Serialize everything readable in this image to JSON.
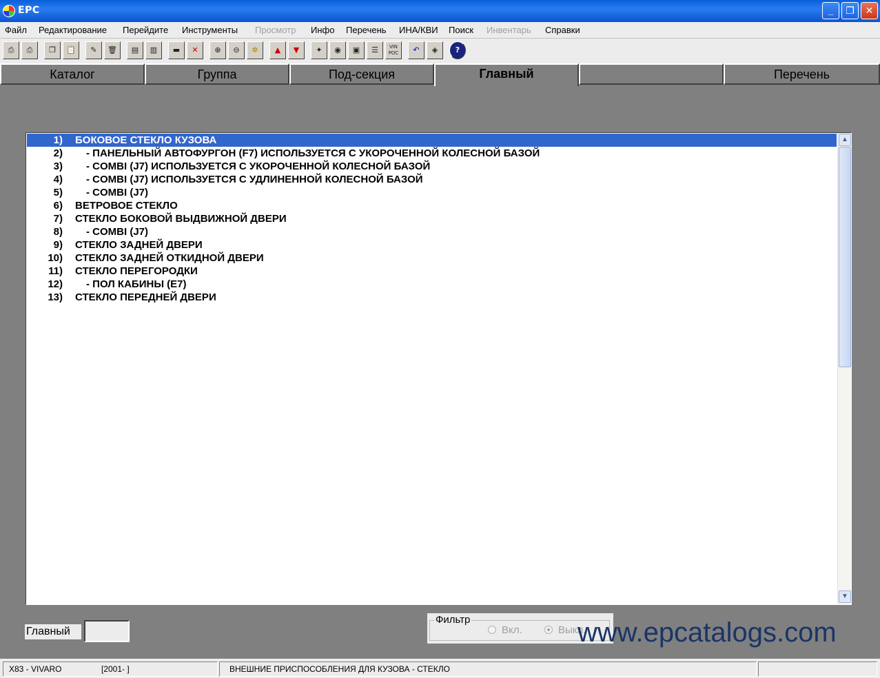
{
  "window": {
    "title": "EPC"
  },
  "menu": [
    {
      "label": "Файл",
      "enabled": true
    },
    {
      "label": "Редактирование",
      "enabled": true
    },
    {
      "label": "Перейдите",
      "enabled": true
    },
    {
      "label": "Инструменты",
      "enabled": true
    },
    {
      "label": "Просмотр",
      "enabled": false
    },
    {
      "label": "Инфо",
      "enabled": true
    },
    {
      "label": "Перечень",
      "enabled": true
    },
    {
      "label": "ИНА/КВИ",
      "enabled": true
    },
    {
      "label": "Поиск",
      "enabled": true
    },
    {
      "label": "Инвентарь",
      "enabled": false
    },
    {
      "label": "Справки",
      "enabled": true
    }
  ],
  "toolbar": {
    "icons": [
      "print-icon",
      "print-preview-icon",
      "copy-icon",
      "paste-icon",
      "edit-pencil-icon",
      "delete-icon",
      "document-icon",
      "book-icon",
      "car-icon",
      "no-car-icon",
      "zoom-in-icon",
      "zoom-out-icon",
      "zoom-fit-icon",
      "warning-up-icon",
      "warning-down-icon",
      "flashlight-icon",
      "cd-icon",
      "monitor-icon",
      "list-icon",
      "vin-icon",
      "undo-icon",
      "layers-icon",
      "help-icon"
    ],
    "vin_label": "VIN\nPOC",
    "help_label": "?"
  },
  "tabs": [
    {
      "label": "Каталог",
      "active": false
    },
    {
      "label": "Группа",
      "active": false
    },
    {
      "label": "Под-секция",
      "active": false
    },
    {
      "label": "Главный",
      "active": true
    },
    {
      "label": "",
      "active": false
    },
    {
      "label": "Перечень",
      "active": false
    }
  ],
  "list": {
    "rows": [
      {
        "num": "1)",
        "text": "БОКОВОЕ СТЕКЛО КУЗОВА",
        "sub": false,
        "selected": true
      },
      {
        "num": "2)",
        "text": "-  ПАНЕЛЬНЫЙ АВТОФУРГОН (F7) ИСПОЛЬЗУЕТСЯ С УКОРОЧЕННОЙ КОЛЕСНОЙ БАЗОЙ",
        "sub": true,
        "selected": false
      },
      {
        "num": "3)",
        "text": "-  COMBI (J7) ИСПОЛЬЗУЕТСЯ С УКОРОЧЕННОЙ КОЛЕСНОЙ БАЗОЙ",
        "sub": true,
        "selected": false
      },
      {
        "num": "4)",
        "text": "-  COMBI (J7) ИСПОЛЬЗУЕТСЯ С УДЛИНЕННОЙ КОЛЕСНОЙ БАЗОЙ",
        "sub": true,
        "selected": false
      },
      {
        "num": "5)",
        "text": "-  COMBI (J7)",
        "sub": true,
        "selected": false
      },
      {
        "num": "6)",
        "text": "ВЕТРОВОЕ СТЕКЛО",
        "sub": false,
        "selected": false
      },
      {
        "num": "7)",
        "text": "СТЕКЛО БОКОВОЙ ВЫДВИЖНОЙ ДВЕРИ",
        "sub": false,
        "selected": false
      },
      {
        "num": "8)",
        "text": "-  COMBI (J7)",
        "sub": true,
        "selected": false
      },
      {
        "num": "9)",
        "text": "СТЕКЛО ЗАДНЕЙ ДВЕРИ",
        "sub": false,
        "selected": false
      },
      {
        "num": "10)",
        "text": "СТЕКЛО ЗАДНЕЙ ОТКИДНОЙ ДВЕРИ",
        "sub": false,
        "selected": false
      },
      {
        "num": "11)",
        "text": "СТЕКЛО ПЕРЕГОРОДКИ",
        "sub": false,
        "selected": false
      },
      {
        "num": "12)",
        "text": "-  ПОЛ КАБИНЫ (E7)",
        "sub": true,
        "selected": false
      },
      {
        "num": "13)",
        "text": "СТЕКЛО ПЕРЕДНЕЙ ДВЕРИ",
        "sub": false,
        "selected": false
      }
    ]
  },
  "bottom": {
    "main_label": "Главный",
    "main_value": "",
    "filter": {
      "legend": "Фильтр",
      "options": [
        {
          "label": "Вкл.",
          "checked": false
        },
        {
          "label": "Выкл.",
          "checked": true
        }
      ]
    }
  },
  "watermark": "www.epcatalogs.com",
  "status": {
    "model": "X83 - VIVARO",
    "years": "[2001-    ]",
    "section": "ВНЕШНИЕ ПРИСПОСОБЛЕНИЯ ДЛЯ КУЗОВА - СТЕКЛО",
    "extra": ""
  },
  "colors": {
    "titlebar": "#0a5fd8",
    "selection": "#3166cc",
    "background": "#808080"
  }
}
